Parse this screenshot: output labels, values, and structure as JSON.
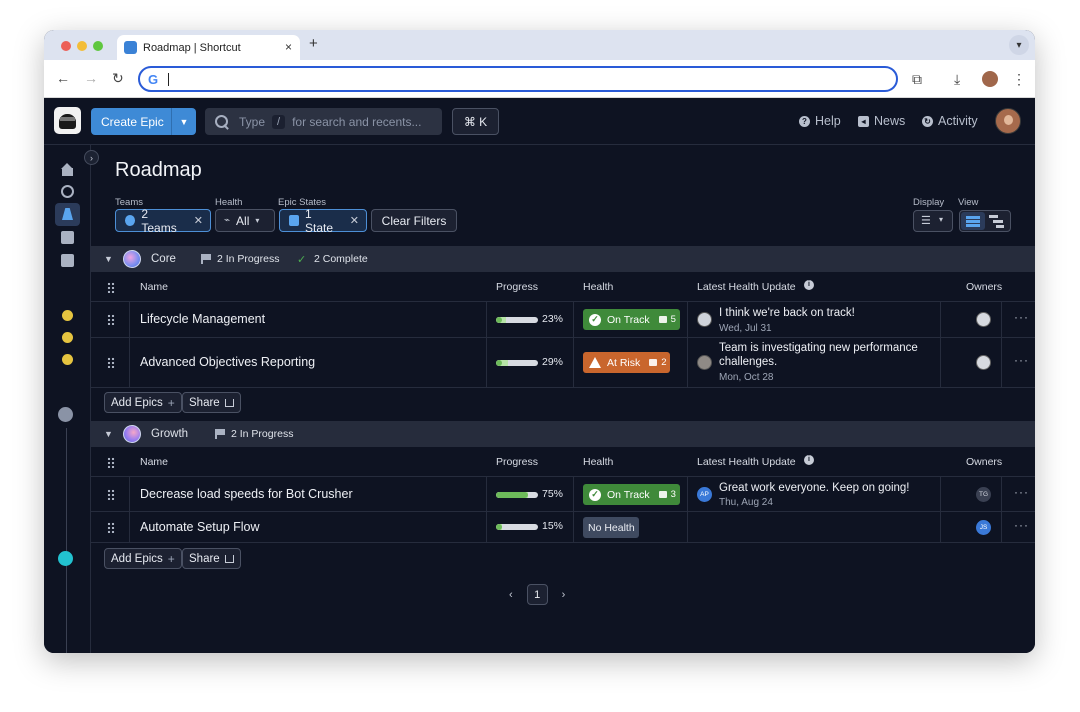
{
  "browser": {
    "tab_title": "Roadmap | Shortcut",
    "tab_close": "×",
    "new_tab": "+",
    "google_glyph": "G",
    "back": "←",
    "forward": "→",
    "reload": "↻",
    "menu": "⋮"
  },
  "topnav": {
    "create_epic_label": "Create Epic",
    "search_type": "Type",
    "search_slash": "/",
    "search_rest": "for search and recents...",
    "cmdk_label": "⌘ K",
    "help_label": "Help",
    "news_label": "News",
    "activity_label": "Activity"
  },
  "page": {
    "title": "Roadmap"
  },
  "filters": {
    "teams_label": "Teams",
    "teams_value": "2 Teams",
    "health_label": "Health",
    "health_value": "All",
    "epic_states_label": "Epic States",
    "epic_states_value": "1 State",
    "clear_label": "Clear Filters",
    "display_label": "Display",
    "view_label": "View"
  },
  "columns": {
    "name": "Name",
    "progress": "Progress",
    "health": "Health",
    "latest_update": "Latest Health Update",
    "owners": "Owners"
  },
  "groups": [
    {
      "name": "Core",
      "in_progress": "2 In Progress",
      "complete": "2 Complete",
      "add_epics": "Add Epics",
      "share": "Share",
      "epics": [
        {
          "name": "Lifecycle Management",
          "progress_done": 0.14,
          "progress_started": 0.23,
          "progress_label": "23%",
          "health": "On Track",
          "comments": "5",
          "update_text": "I think we're back on track!",
          "update_date": "Wed, Jul 31"
        },
        {
          "name": "Advanced Objectives Reporting",
          "progress_done": 0.15,
          "progress_started": 0.29,
          "progress_label": "29%",
          "health": "At Risk",
          "comments": "2",
          "update_text": "Team is investigating new performance challenges.",
          "update_date": "Mon, Oct 28"
        }
      ]
    },
    {
      "name": "Growth",
      "in_progress": "2 In Progress",
      "add_epics": "Add Epics",
      "share": "Share",
      "epics": [
        {
          "name": "Decrease load speeds for Bot Crusher",
          "progress_done": 0.75,
          "progress_started": 0.75,
          "progress_label": "75%",
          "health": "On Track",
          "comments": "3",
          "update_author_initials": "AP",
          "update_text": "Great work everyone. Keep on going!",
          "update_date": "Thu, Aug 24",
          "owner_initials": "TG"
        },
        {
          "name": "Automate Setup Flow",
          "progress_done": 0.15,
          "progress_started": 0.15,
          "progress_label": "15%",
          "health": "No Health",
          "owner_initials": "JS"
        }
      ]
    }
  ],
  "pagination": {
    "current": "1",
    "prev": "‹",
    "next": "›"
  },
  "colors": {
    "accent": "#3e8ad6",
    "on_track": "#3f8a3a",
    "at_risk": "#c9662d",
    "no_health": "#3f4a60",
    "progress": "#6dba5a",
    "background": "#0e1322"
  }
}
